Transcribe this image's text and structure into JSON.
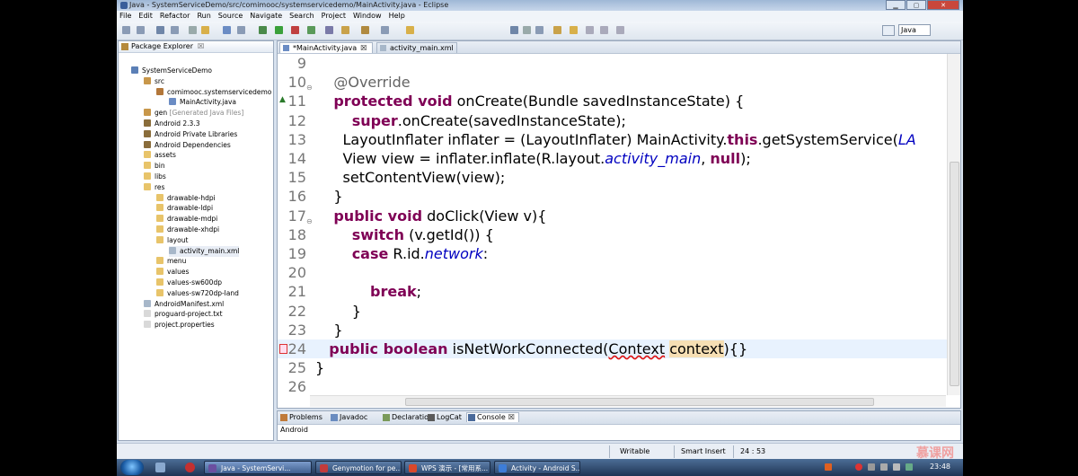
{
  "window": {
    "title": "Java - SystemServiceDemo/src/comimooc/systemservicedemo/MainActivity.java - Eclipse"
  },
  "menu": [
    "File",
    "Edit",
    "Refactor",
    "Run",
    "Source",
    "Navigate",
    "Search",
    "Project",
    "Window",
    "Help"
  ],
  "perspective": {
    "label": "Java"
  },
  "package_explorer": {
    "title": "Package Explorer",
    "close": "☒",
    "tree": [
      {
        "label": "SystemServiceDemo",
        "extra": "",
        "icon_color": "#5b7fb6"
      },
      {
        "label": "src",
        "extra": "",
        "icon_color": "#c8974a"
      },
      {
        "label": "comimooc.systemservicedemo",
        "extra": "",
        "icon_color": "#b3773a"
      },
      {
        "label": "MainActivity.java",
        "extra": "",
        "icon_color": "#6b8cc4"
      },
      {
        "label": "gen",
        "extra": "[Generated Java Files]",
        "icon_color": "#c8974a"
      },
      {
        "label": "Android 2.3.3",
        "extra": "",
        "icon_color": "#8a6d3b"
      },
      {
        "label": "Android Private Libraries",
        "extra": "",
        "icon_color": "#8a6d3b"
      },
      {
        "label": "Android Dependencies",
        "extra": "",
        "icon_color": "#8a6d3b"
      },
      {
        "label": "assets",
        "extra": "",
        "icon_color": "#e8c46a"
      },
      {
        "label": "bin",
        "extra": "",
        "icon_color": "#e8c46a"
      },
      {
        "label": "libs",
        "extra": "",
        "icon_color": "#e8c46a"
      },
      {
        "label": "res",
        "extra": "",
        "icon_color": "#e8c46a"
      },
      {
        "label": "drawable-hdpi",
        "extra": "",
        "icon_color": "#e8c46a"
      },
      {
        "label": "drawable-ldpi",
        "extra": "",
        "icon_color": "#e8c46a"
      },
      {
        "label": "drawable-mdpi",
        "extra": "",
        "icon_color": "#e8c46a"
      },
      {
        "label": "drawable-xhdpi",
        "extra": "",
        "icon_color": "#e8c46a"
      },
      {
        "label": "layout",
        "extra": "",
        "icon_color": "#e8c46a"
      },
      {
        "label": "activity_main.xml",
        "extra": "",
        "icon_color": "#a7b7c9"
      },
      {
        "label": "menu",
        "extra": "",
        "icon_color": "#e8c46a"
      },
      {
        "label": "values",
        "extra": "",
        "icon_color": "#e8c46a"
      },
      {
        "label": "values-sw600dp",
        "extra": "",
        "icon_color": "#e8c46a"
      },
      {
        "label": "values-sw720dp-land",
        "extra": "",
        "icon_color": "#e8c46a"
      },
      {
        "label": "AndroidManifest.xml",
        "extra": "",
        "icon_color": "#a7b7c9"
      },
      {
        "label": "proguard-project.txt",
        "extra": "",
        "icon_color": "#d9d9d9"
      },
      {
        "label": "project.properties",
        "extra": "",
        "icon_color": "#d9d9d9"
      }
    ]
  },
  "editor": {
    "tabs": [
      {
        "label": "*MainActivity.java",
        "close": "☒",
        "icon_color": "#6b8cc4"
      },
      {
        "label": "activity_main.xml",
        "icon_color": "#a7b7c9"
      }
    ],
    "lines": [
      {
        "n": "9",
        "marker": "",
        "parts": []
      },
      {
        "n": "10",
        "marker": "fold",
        "parts": [
          {
            "t": "    "
          },
          {
            "t": "@Override",
            "c": "ann"
          }
        ]
      },
      {
        "n": "11",
        "marker": "override",
        "parts": [
          {
            "t": "    "
          },
          {
            "t": "protected void",
            "c": "kw"
          },
          {
            "t": " onCreate(Bundle savedInstanceState) {"
          }
        ]
      },
      {
        "n": "12",
        "marker": "",
        "parts": [
          {
            "t": "        "
          },
          {
            "t": "super",
            "c": "kw"
          },
          {
            "t": ".onCreate(savedInstanceState);"
          }
        ]
      },
      {
        "n": "13",
        "marker": "",
        "parts": [
          {
            "t": "      LayoutInflater inflater = (LayoutInflater) MainActivity."
          },
          {
            "t": "this",
            "c": "kw"
          },
          {
            "t": ".getSystemService("
          },
          {
            "t": "LA",
            "c": "it"
          }
        ]
      },
      {
        "n": "14",
        "marker": "",
        "parts": [
          {
            "t": "      View view = inflater.inflate(R.layout."
          },
          {
            "t": "activity_main",
            "c": "it"
          },
          {
            "t": ", "
          },
          {
            "t": "null",
            "c": "kw"
          },
          {
            "t": ");"
          }
        ]
      },
      {
        "n": "15",
        "marker": "",
        "parts": [
          {
            "t": "      setContentView(view);"
          }
        ]
      },
      {
        "n": "16",
        "marker": "",
        "parts": [
          {
            "t": "    }"
          }
        ]
      },
      {
        "n": "17",
        "marker": "fold",
        "parts": [
          {
            "t": "    "
          },
          {
            "t": "public void",
            "c": "kw"
          },
          {
            "t": " doClick(View v){"
          }
        ]
      },
      {
        "n": "18",
        "marker": "",
        "parts": [
          {
            "t": "        "
          },
          {
            "t": "switch",
            "c": "kw"
          },
          {
            "t": " (v.getId()) {"
          }
        ]
      },
      {
        "n": "19",
        "marker": "",
        "parts": [
          {
            "t": "        "
          },
          {
            "t": "case",
            "c": "kw"
          },
          {
            "t": " R.id."
          },
          {
            "t": "network",
            "c": "it"
          },
          {
            "t": ":"
          }
        ]
      },
      {
        "n": "20",
        "marker": "",
        "parts": []
      },
      {
        "n": "21",
        "marker": "",
        "parts": [
          {
            "t": "            "
          },
          {
            "t": "break",
            "c": "kw"
          },
          {
            "t": ";"
          }
        ]
      },
      {
        "n": "22",
        "marker": "",
        "parts": [
          {
            "t": "        }"
          }
        ]
      },
      {
        "n": "23",
        "marker": "",
        "parts": [
          {
            "t": "    }"
          }
        ]
      },
      {
        "n": "24",
        "marker": "error",
        "parts": [
          {
            "t": "   "
          },
          {
            "t": "public boolean",
            "c": "kw"
          },
          {
            "t": " isNetWorkConnected("
          },
          {
            "t": "Context",
            "c": "wavy"
          },
          {
            "t": " "
          },
          {
            "t": "context",
            "c": "occ"
          },
          {
            "t": "){}"
          }
        ]
      },
      {
        "n": "25",
        "marker": "",
        "parts": [
          {
            "t": "}"
          }
        ]
      },
      {
        "n": "26",
        "marker": "",
        "parts": []
      }
    ],
    "current_line": "24"
  },
  "bottom_panel": {
    "tabs": [
      {
        "label": "Problems",
        "icon_color": "#c07a3a"
      },
      {
        "label": "Javadoc",
        "icon_color": "#6a8cc0"
      },
      {
        "label": "Declaration",
        "icon_color": "#7a9a5a"
      },
      {
        "label": "LogCat",
        "icon_color": "#5a5a5a"
      },
      {
        "label": "Console",
        "icon_color": "#4a6a9a",
        "close": "☒"
      }
    ],
    "console_text": "Android"
  },
  "status": {
    "mode": "Writable",
    "insert": "Smart Insert",
    "position": "24 : 53",
    "watermark": "慕课网"
  },
  "taskbar": {
    "tasks": [
      {
        "label": "Java - SystemServi...",
        "icon_color": "#6b4fa0"
      },
      {
        "label": "Genymotion for pe...",
        "icon_color": "#c23b3b"
      },
      {
        "label": "WPS 演示 - [常用系...",
        "icon_color": "#d9482b"
      },
      {
        "label": "Activity - Android S...",
        "icon_color": "#3d7dd8"
      }
    ],
    "clock": "23:48"
  },
  "colors": {
    "keyword": "#7f0055",
    "annotation": "#646464",
    "field": "#0000c0",
    "current_line": "#e8f2fe"
  }
}
